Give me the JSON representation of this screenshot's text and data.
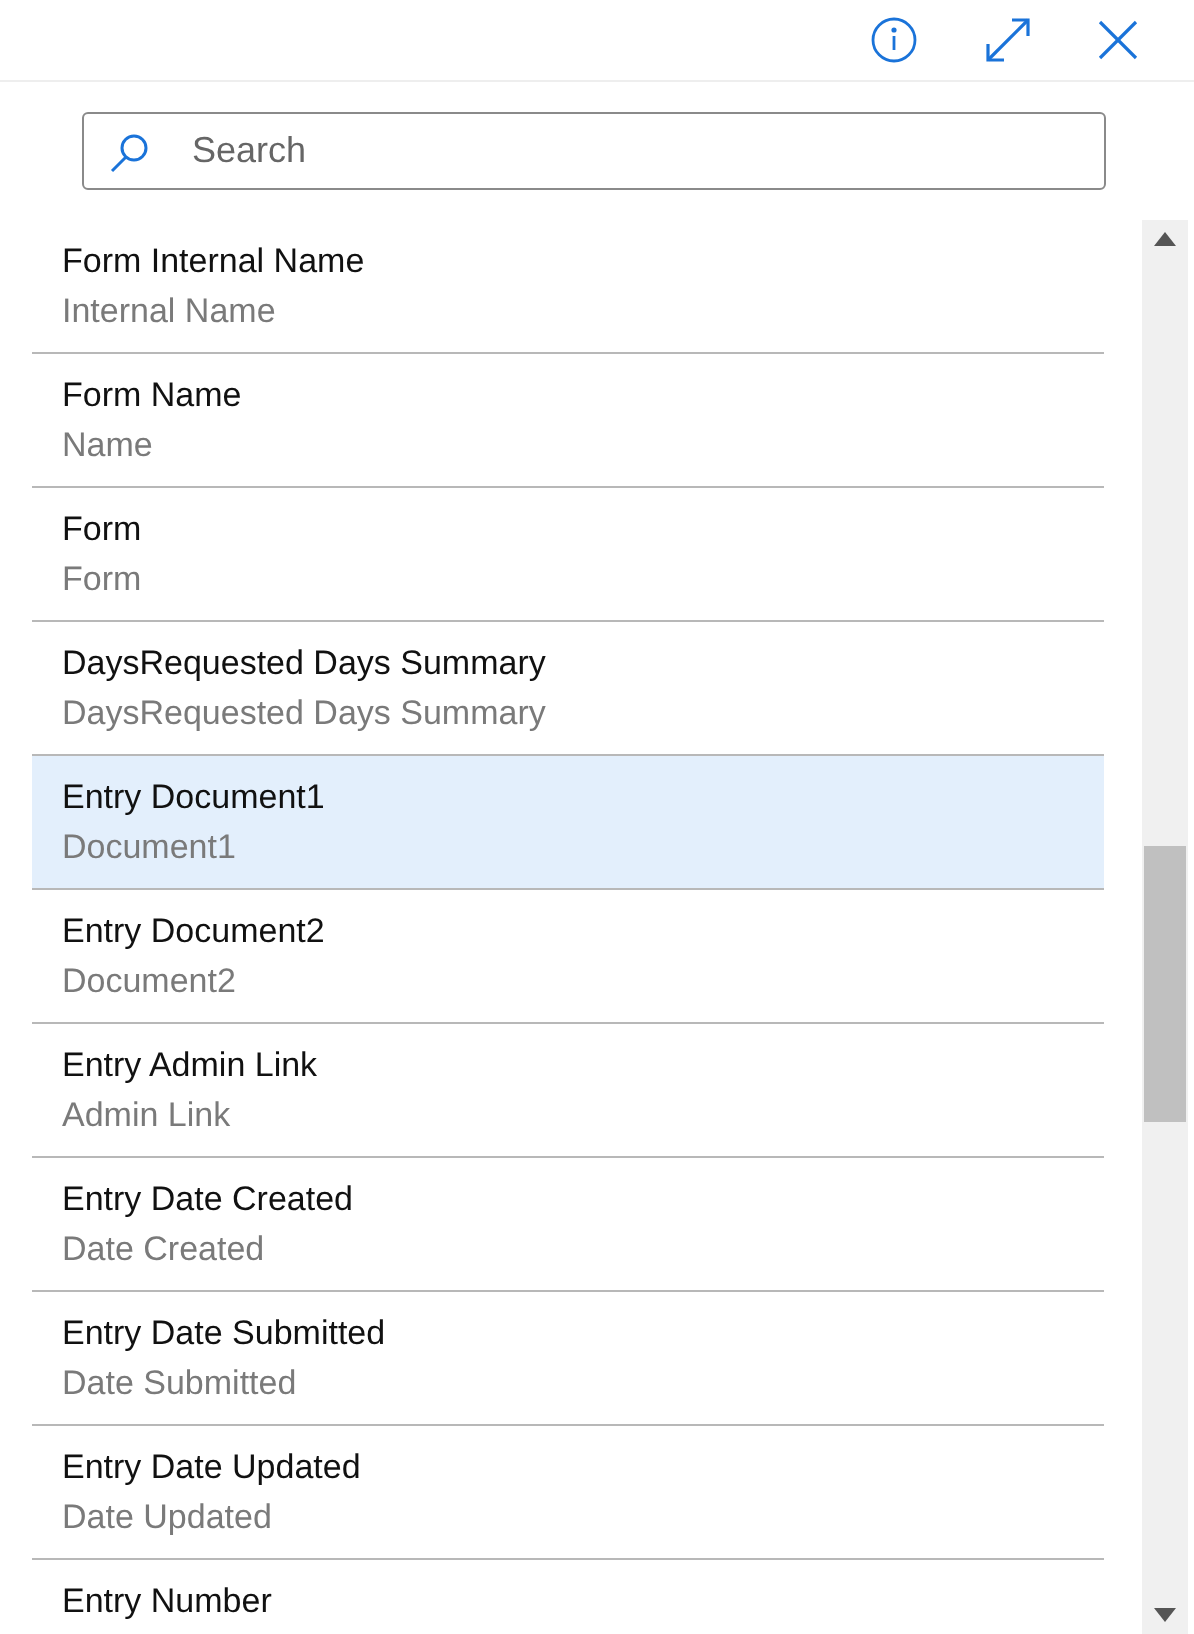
{
  "search": {
    "placeholder": "Search"
  },
  "items": [
    {
      "title": "Form Internal Name",
      "subtitle": "Internal Name",
      "selected": false
    },
    {
      "title": "Form Name",
      "subtitle": "Name",
      "selected": false
    },
    {
      "title": "Form",
      "subtitle": "Form",
      "selected": false
    },
    {
      "title": "DaysRequested Days Summary",
      "subtitle": "DaysRequested Days Summary",
      "selected": false
    },
    {
      "title": "Entry Document1",
      "subtitle": "Document1",
      "selected": true
    },
    {
      "title": "Entry Document2",
      "subtitle": "Document2",
      "selected": false
    },
    {
      "title": "Entry Admin Link",
      "subtitle": "Admin Link",
      "selected": false
    },
    {
      "title": "Entry Date Created",
      "subtitle": "Date Created",
      "selected": false
    },
    {
      "title": "Entry Date Submitted",
      "subtitle": "Date Submitted",
      "selected": false
    },
    {
      "title": "Entry Date Updated",
      "subtitle": "Date Updated",
      "selected": false
    },
    {
      "title": "Entry Number",
      "selected": false
    }
  ]
}
